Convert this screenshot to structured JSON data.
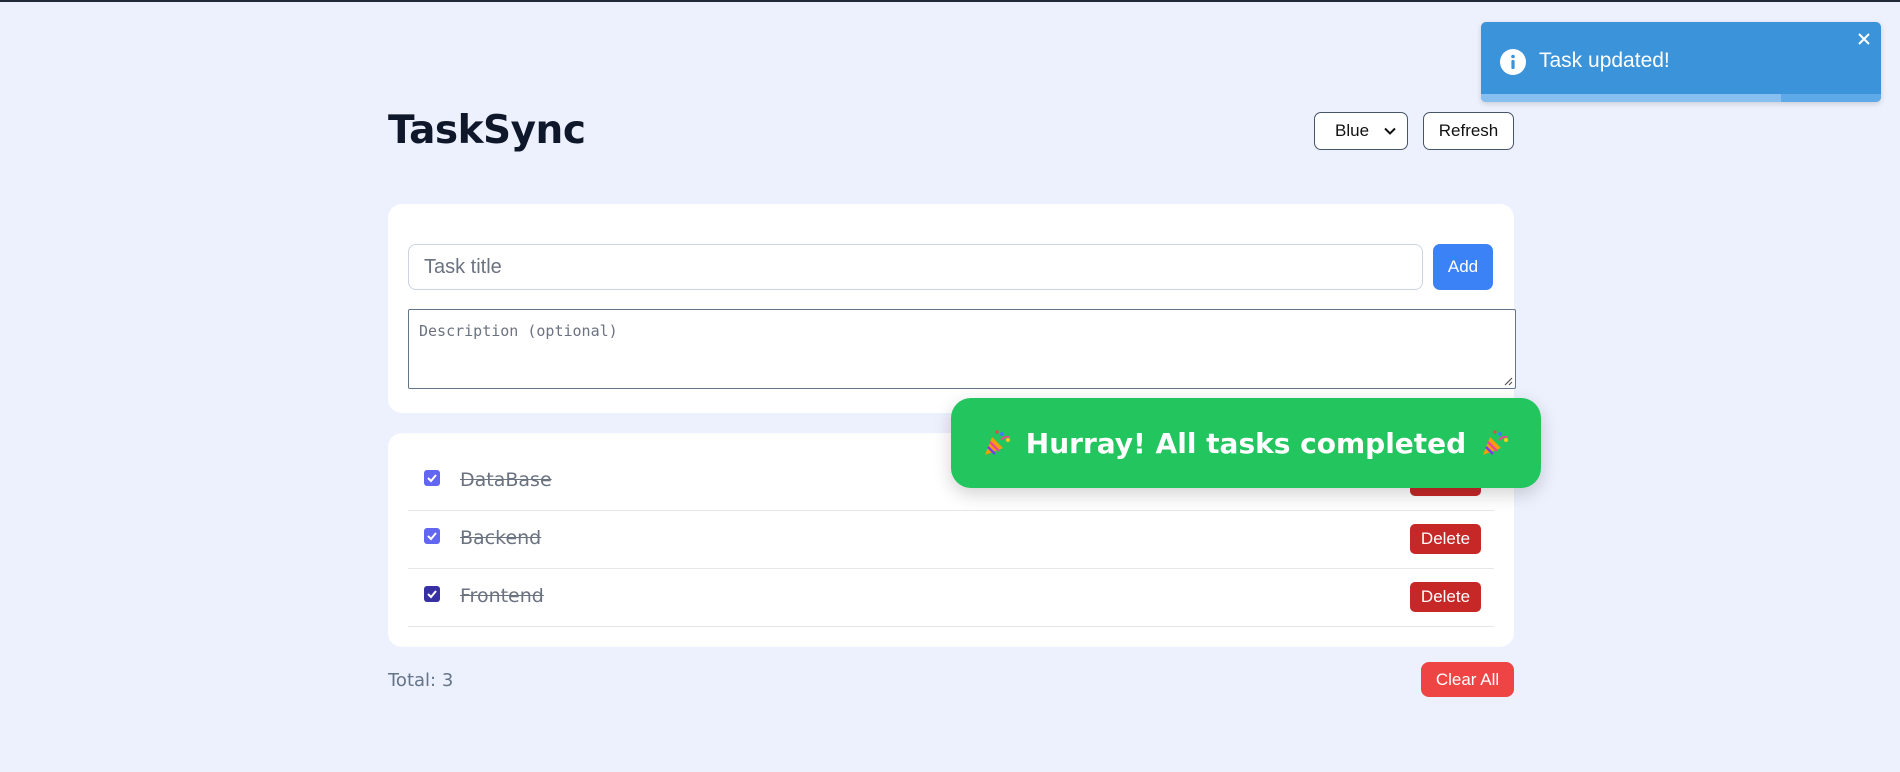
{
  "app": {
    "title": "TaskSync"
  },
  "header": {
    "theme_select": {
      "value": "Blue"
    },
    "refresh_label": "Refresh"
  },
  "form": {
    "title_placeholder": "Task title",
    "add_label": "Add",
    "description_placeholder": "Description (optional)"
  },
  "tasks": [
    {
      "title": "DataBase",
      "completed": true,
      "delete_label": "Delete"
    },
    {
      "title": "Backend",
      "completed": true,
      "delete_label": "Delete"
    },
    {
      "title": "Frontend",
      "completed": true,
      "delete_label": "Delete"
    }
  ],
  "footer": {
    "total_label": "Total: 3",
    "clear_label": "Clear All"
  },
  "celebration": {
    "message": "Hurray! All tasks completed",
    "icon": "party-popper-icon"
  },
  "toast": {
    "message": "Task updated!",
    "icon": "info-icon",
    "progress_remaining": 0.75
  },
  "colors": {
    "page_bg": "#edf1fd",
    "primary": "#3b82f6",
    "danger": "#c62828",
    "clear": "#ef4444",
    "success": "#22c55e",
    "toast_info": "#3b93d9",
    "checkbox": "#6366f1"
  }
}
